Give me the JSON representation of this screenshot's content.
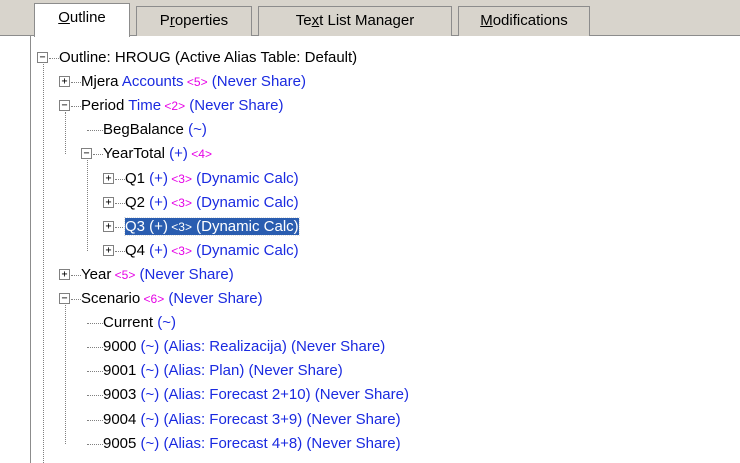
{
  "tabs": [
    {
      "label": "Outline",
      "underline_index": 0,
      "active": true
    },
    {
      "label": "Properties",
      "underline_index": 1,
      "active": false
    },
    {
      "label": "Text List Manager",
      "underline_index": 2,
      "active": false
    },
    {
      "label": "Modifications",
      "underline_index": 0,
      "active": false
    }
  ],
  "tree": {
    "root": {
      "name": "Outline: HROUG (Active Alias Table: Default)",
      "expanded": true
    },
    "nodes": [
      {
        "id": "mjera",
        "name": "Mjera",
        "parts": [
          {
            "t": " Accounts",
            "c": "attr"
          },
          {
            "t": " <5>",
            "c": "mag"
          },
          {
            "t": " (Never Share)",
            "c": "attr"
          }
        ],
        "expanded": false,
        "level": 1
      },
      {
        "id": "period",
        "name": "Period",
        "parts": [
          {
            "t": " Time",
            "c": "attr"
          },
          {
            "t": " <2>",
            "c": "mag"
          },
          {
            "t": " (Never Share)",
            "c": "attr"
          }
        ],
        "expanded": true,
        "level": 1
      },
      {
        "id": "begbalance",
        "name": "BegBalance",
        "parts": [
          {
            "t": " (~)",
            "c": "attr"
          }
        ],
        "leaf": true,
        "level": 2
      },
      {
        "id": "yeartotal",
        "name": "YearTotal",
        "parts": [
          {
            "t": " (+)",
            "c": "attr"
          },
          {
            "t": " <4>",
            "c": "mag"
          }
        ],
        "expanded": true,
        "level": 2
      },
      {
        "id": "q1",
        "name": "Q1",
        "parts": [
          {
            "t": " (+)",
            "c": "attr"
          },
          {
            "t": " <3>",
            "c": "mag"
          },
          {
            "t": " (Dynamic Calc)",
            "c": "attr"
          }
        ],
        "expanded": false,
        "level": 3
      },
      {
        "id": "q2",
        "name": "Q2",
        "parts": [
          {
            "t": " (+)",
            "c": "attr"
          },
          {
            "t": " <3>",
            "c": "mag"
          },
          {
            "t": " (Dynamic Calc)",
            "c": "attr"
          }
        ],
        "expanded": false,
        "level": 3
      },
      {
        "id": "q3",
        "name": "Q3",
        "parts": [
          {
            "t": " (+)",
            "c": "attr"
          },
          {
            "t": " <3>",
            "c": "mag"
          },
          {
            "t": " (Dynamic Calc)",
            "c": "attr"
          }
        ],
        "expanded": false,
        "level": 3,
        "selected": true
      },
      {
        "id": "q4",
        "name": "Q4",
        "parts": [
          {
            "t": " (+)",
            "c": "attr"
          },
          {
            "t": " <3>",
            "c": "mag"
          },
          {
            "t": " (Dynamic Calc)",
            "c": "attr"
          }
        ],
        "expanded": false,
        "level": 3
      },
      {
        "id": "year",
        "name": "Year",
        "parts": [
          {
            "t": " <5>",
            "c": "mag"
          },
          {
            "t": " (Never Share)",
            "c": "attr"
          }
        ],
        "expanded": false,
        "level": 1
      },
      {
        "id": "scenario",
        "name": "Scenario",
        "parts": [
          {
            "t": " <6>",
            "c": "mag"
          },
          {
            "t": " (Never Share)",
            "c": "attr"
          }
        ],
        "expanded": true,
        "level": 1
      },
      {
        "id": "current",
        "name": "Current",
        "parts": [
          {
            "t": " (~)",
            "c": "attr"
          }
        ],
        "leaf": true,
        "level": 2
      },
      {
        "id": "s9000",
        "name": "9000",
        "parts": [
          {
            "t": " (~) (Alias: Realizacija) (Never Share)",
            "c": "attr"
          }
        ],
        "leaf": true,
        "level": 2
      },
      {
        "id": "s9001",
        "name": "9001",
        "parts": [
          {
            "t": " (~) (Alias: Plan) (Never Share)",
            "c": "attr"
          }
        ],
        "leaf": true,
        "level": 2
      },
      {
        "id": "s9003",
        "name": "9003",
        "parts": [
          {
            "t": " (~) (Alias: Forecast 2+10) (Never Share)",
            "c": "attr"
          }
        ],
        "leaf": true,
        "level": 2
      },
      {
        "id": "s9004",
        "name": "9004",
        "parts": [
          {
            "t": " (~) (Alias: Forecast 3+9) (Never Share)",
            "c": "attr"
          }
        ],
        "leaf": true,
        "level": 2
      },
      {
        "id": "s9005",
        "name": "9005",
        "parts": [
          {
            "t": " (~) (Alias: Forecast 4+8) (Never Share)",
            "c": "attr"
          }
        ],
        "leaf": true,
        "level": 2
      }
    ]
  },
  "colors": {
    "name": "#000000",
    "attr": "#1a2ae0",
    "mag": "#e600e6",
    "selection": "#2a5db0"
  }
}
